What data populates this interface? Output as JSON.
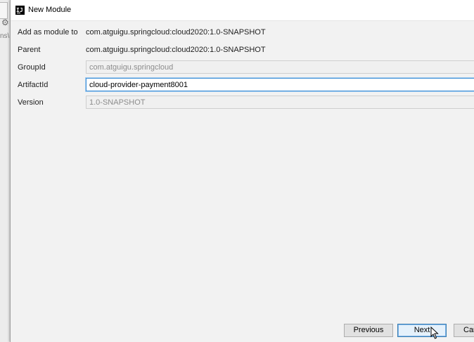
{
  "background": {
    "gear_icon": "⚙",
    "path_fragment": "ns\\"
  },
  "dialog": {
    "title": "New Module",
    "app_icon_text": "IJ"
  },
  "form": {
    "add_as_module_to": {
      "label": "Add as module to",
      "value": "com.atguigu.springcloud:cloud2020:1.0-SNAPSHOT"
    },
    "parent": {
      "label": "Parent",
      "value": "com.atguigu.springcloud:cloud2020:1.0-SNAPSHOT"
    },
    "group_id": {
      "label": "GroupId",
      "value": "com.atguigu.springcloud"
    },
    "artifact_id": {
      "label": "ArtifactId",
      "value": "cloud-provider-payment8001"
    },
    "version": {
      "label": "Version",
      "value": "1.0-SNAPSHOT"
    }
  },
  "buttons": {
    "previous": "Previous",
    "next": "Next",
    "cancel": "Cancel"
  },
  "colors": {
    "focus_border": "#3d8fd6",
    "default_button_border": "#3c7fb1",
    "dialog_background": "#f2f2f2"
  }
}
